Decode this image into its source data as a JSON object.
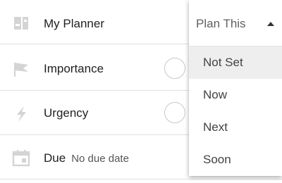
{
  "rows": [
    {
      "label": "My Planner",
      "icon": "planner-icon"
    },
    {
      "label": "Importance",
      "icon": "flag-icon"
    },
    {
      "label": "Urgency",
      "icon": "lightning-icon"
    },
    {
      "label": "Due",
      "sub": "No due date",
      "icon": "calendar-icon"
    }
  ],
  "dropdown": {
    "value": "Plan This",
    "options": [
      "Not Set",
      "Now",
      "Next",
      "Soon"
    ],
    "highlighted": "Not Set"
  },
  "colors": {
    "icon": "#d4d4d4",
    "text": "#212121",
    "highlight": "#eeeeee"
  }
}
